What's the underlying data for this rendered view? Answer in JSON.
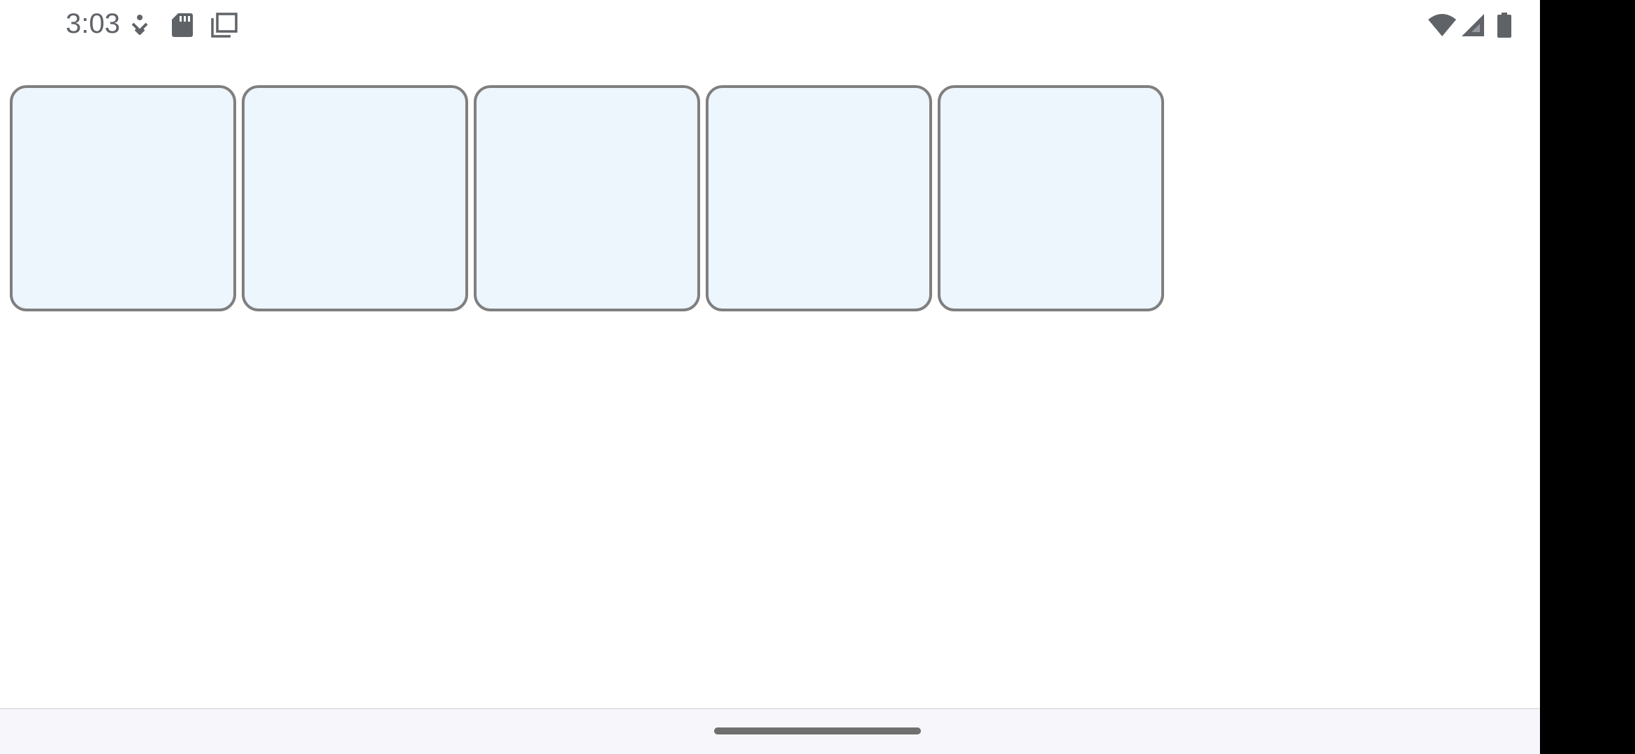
{
  "status_bar": {
    "time": "3:03",
    "left_icons": [
      "assistant-icon",
      "sd-card-icon",
      "screenshot-icon"
    ],
    "right_icons": [
      "wifi-icon",
      "signal-icon",
      "battery-icon"
    ],
    "icon_color": "#5f6368"
  },
  "tiles": {
    "count": 5,
    "fill_color": "#edf5fd",
    "border_color": "#7f7f7f"
  },
  "nav_bar": {
    "handle_color": "#6f6f6f",
    "background": "#f7f7fb"
  }
}
